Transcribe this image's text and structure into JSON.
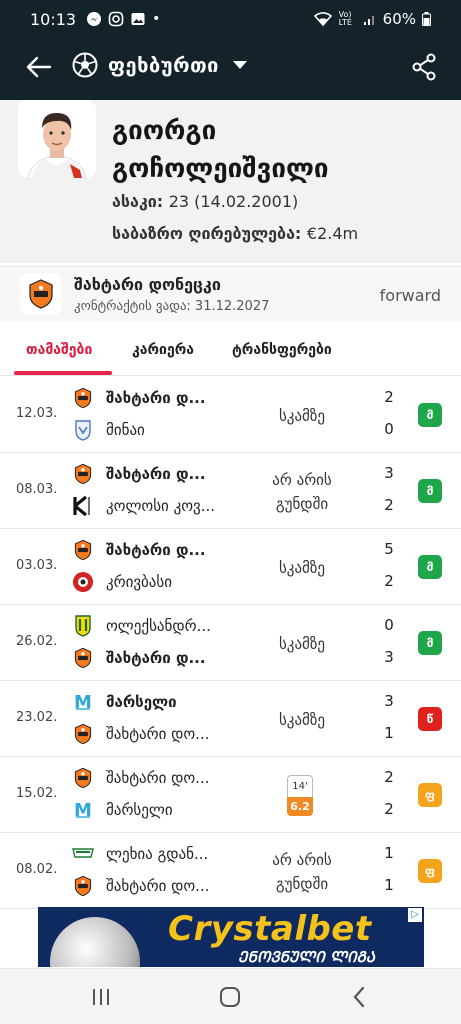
{
  "status_bar": {
    "time": "10:13",
    "network": "Vo) LTE",
    "battery": "60%"
  },
  "app_bar": {
    "title": "ფეხბურთი"
  },
  "player": {
    "first_name": "გიორგი",
    "last_name": "გოჩოლეიშვილი",
    "age_label": "ასაკი:",
    "age_value": "23 (14.02.2001)",
    "market_label": "საბაზრო ღირებულება:",
    "market_value": "€2.4m"
  },
  "club": {
    "name": "შახტარი დონეცკი",
    "contract": "კონტრაქტის ვადა: 31.12.2027",
    "position": "forward"
  },
  "tabs": [
    {
      "label": "თამაშები",
      "active": true
    },
    {
      "label": "კარიერა",
      "active": false
    },
    {
      "label": "ტრანსფერები",
      "active": false
    }
  ],
  "matches": [
    {
      "date": "12.03.",
      "home": "შახტარი დ...",
      "away": "მინაი",
      "home_bold": true,
      "away_bold": false,
      "home_logo": "shakhtar",
      "away_logo": "minai",
      "status": "სკამზე",
      "home_score": "2",
      "away_score": "0",
      "result": "მ",
      "result_color": "#1fa64a"
    },
    {
      "date": "08.03.",
      "home": "შახტარი დ...",
      "away": "კოლოსი კოვ...",
      "home_bold": true,
      "away_bold": false,
      "home_logo": "shakhtar",
      "away_logo": "kolos",
      "status": "არ არის გუნდში",
      "home_score": "3",
      "away_score": "2",
      "result": "მ",
      "result_color": "#1fa64a"
    },
    {
      "date": "03.03.",
      "home": "შახტარი დ...",
      "away": "კრივბასი",
      "home_bold": true,
      "away_bold": false,
      "home_logo": "shakhtar",
      "away_logo": "kryvbas",
      "status": "სკამზე",
      "home_score": "5",
      "away_score": "2",
      "result": "მ",
      "result_color": "#1fa64a"
    },
    {
      "date": "26.02.",
      "home": "ოლექსანდრ...",
      "away": "შახტარი დ...",
      "home_bold": false,
      "away_bold": true,
      "home_logo": "oleksandriya",
      "away_logo": "shakhtar",
      "status": "სკამზე",
      "home_score": "0",
      "away_score": "3",
      "result": "მ",
      "result_color": "#1fa64a"
    },
    {
      "date": "23.02.",
      "home": "მარსელი",
      "away": "შახტარი დო...",
      "home_bold": true,
      "away_bold": false,
      "home_logo": "marseille",
      "away_logo": "shakhtar",
      "status": "სკამზე",
      "home_score": "3",
      "away_score": "1",
      "result": "წ",
      "result_color": "#e0221f"
    },
    {
      "date": "15.02.",
      "home": "შახტარი დო...",
      "away": "მარსელი",
      "home_bold": false,
      "away_bold": false,
      "home_logo": "shakhtar",
      "away_logo": "marseille",
      "status": "",
      "minutes": "14'",
      "rating": "6.2",
      "home_score": "2",
      "away_score": "2",
      "result": "ფ",
      "result_color": "#f5a31c"
    },
    {
      "date": "08.02.",
      "home": "ლეხია გდან...",
      "away": "შახტარი დო...",
      "home_bold": false,
      "away_bold": false,
      "home_logo": "lechia",
      "away_logo": "shakhtar",
      "status": "არ არის გუნდში",
      "home_score": "1",
      "away_score": "1",
      "result": "ფ",
      "result_color": "#f5a31c"
    }
  ],
  "ad": {
    "brand": "Crystalbet",
    "tagline": "ᲔᲜᲝᲕᲜᲣᲚᲘ ᲚᲘᲒᲐ"
  },
  "colors": {
    "appbar_bg": "#14232a",
    "accent": "#e8234a",
    "win": "#1fa64a",
    "loss": "#e0221f",
    "draw": "#f5a31c"
  }
}
